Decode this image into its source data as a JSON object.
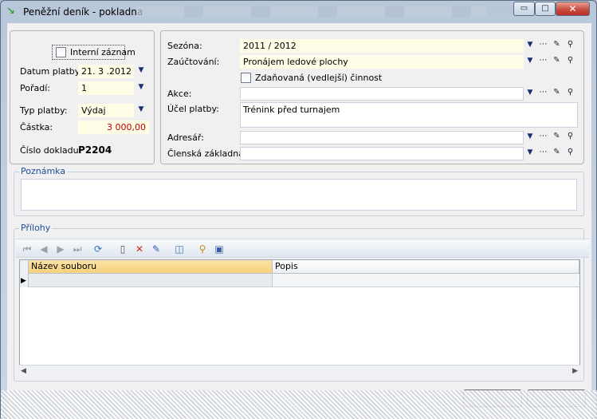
{
  "window": {
    "title": "Peněžní deník - pokladna",
    "min_label": "▭",
    "max_label": "□",
    "close_label": "✕"
  },
  "left": {
    "intern_label": "Interní záznam",
    "datum_label": "Datum platby:",
    "datum_value": "21. 3 .2012",
    "poradi_label": "Pořadí:",
    "poradi_value": "1",
    "typ_label": "Typ platby:",
    "typ_value": "Výdaj",
    "castka_label": "Částka:",
    "castka_value": "3 000,00",
    "cislo_label": "Číslo dokladu:",
    "cislo_value": "P2204"
  },
  "right": {
    "sezona_label": "Sezóna:",
    "sezona_value": "2011 / 2012",
    "zauc_label": "Zaúčtování:",
    "zauc_value": "Pronájem ledové plochy",
    "zdan_label": "Zdaňovaná (vedlejší) činnost",
    "akce_label": "Akce:",
    "akce_value": "",
    "ucel_label": "Účel platby:",
    "ucel_value": "Trénink před turnajem",
    "adresar_label": "Adresář:",
    "adresar_value": "",
    "clenska_label": "Členská základna:",
    "clenska_value": ""
  },
  "poznamka": {
    "title": "Poznámka"
  },
  "prilohy": {
    "title": "Přílohy",
    "columns": [
      "Název souboru",
      "Popis"
    ]
  },
  "icons": {
    "dropdown": "chevron-down-icon",
    "dots": "ellipsis-icon",
    "edit": "pencil-icon",
    "search": "magnifier-icon"
  },
  "colors": {
    "field_bg": "#fffde6",
    "group_title": "#1f4e98",
    "amount_text": "#c00000",
    "header_highlight": "#f7d17b"
  }
}
